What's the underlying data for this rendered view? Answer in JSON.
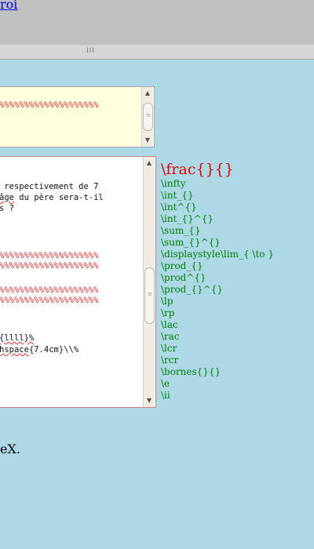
{
  "top": {
    "link_text": "roi"
  },
  "splitter": {
    "grip": "III"
  },
  "box1": {
    "lines": [
      "%%%%%%%%%%%%%%%%%%%%"
    ]
  },
  "box2": {
    "lines": [
      " respectivement de 7",
      "âge du père sera-t-il",
      "s ?",
      "",
      "",
      "",
      "%%%%%%%%%%%%%%%%%%%%",
      "%%%%%%%%%%%%%%%%%%%%",
      "",
      "%%%%%%%%%%%%%%%%%%%%",
      "%%%%%%%%%%%%%%%%%%%%",
      "",
      "",
      "{llll}%",
      "hspace{7.4cm}\\\\%"
    ]
  },
  "commands": {
    "heading": "\\frac{}{}",
    "items": [
      "\\infty",
      "\\int_{}",
      "\\int^{}",
      "\\int_{}^{}",
      "\\sum_{}",
      "\\sum_{}^{}",
      "\\displaystyle\\lim_{ \\to }",
      "\\prod_{}",
      "\\prod^{}",
      "\\prod_{}^{}",
      "\\lp",
      "\\rp",
      "\\lac",
      "\\rac",
      "\\lcr",
      "\\rcr",
      "\\bornes{}{}",
      "\\e",
      "\\ii"
    ]
  },
  "footer": {
    "text": "eX."
  },
  "colors": {
    "background": "#add8e6",
    "heading": "#e00000",
    "command": "#008000"
  }
}
